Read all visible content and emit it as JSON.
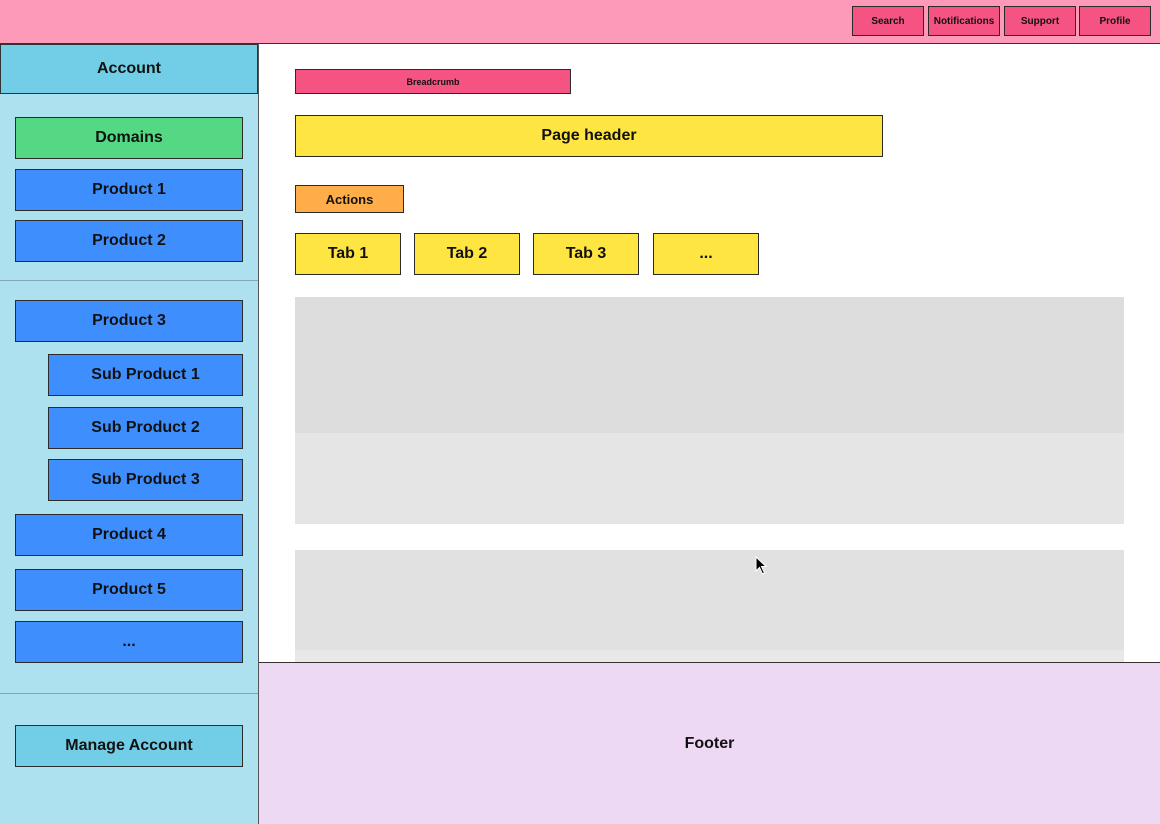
{
  "topbar": {
    "buttons": [
      "Search",
      "Notifications",
      "Support",
      "Profile"
    ]
  },
  "sidebar": {
    "header": "Account",
    "domains": "Domains",
    "items": [
      "Product 1",
      "Product 2",
      "Product 3",
      "Sub Product 1",
      "Sub Product 2",
      "Sub Product 3",
      "Product 4",
      "Product 5",
      "..."
    ],
    "manage": "Manage Account"
  },
  "main": {
    "breadcrumb": "Breadcrumb",
    "page_header": "Page header",
    "actions": "Actions",
    "tabs": [
      "Tab 1",
      "Tab 2",
      "Tab 3",
      "..."
    ]
  },
  "footer": "Footer",
  "colors": {
    "topbar": "#fd99b9",
    "top_button": "#f55382",
    "sidebar": "#ade1ef",
    "sidebar_header": "#72cde6",
    "domains": "#54d883",
    "product": "#3f8efd",
    "breadcrumb": "#f55382",
    "header": "#ffe541",
    "actions": "#fead48",
    "panel": "#dddddd",
    "footer": "#eed9f4"
  },
  "icons": {
    "cursor": "mouse-pointer-icon"
  }
}
